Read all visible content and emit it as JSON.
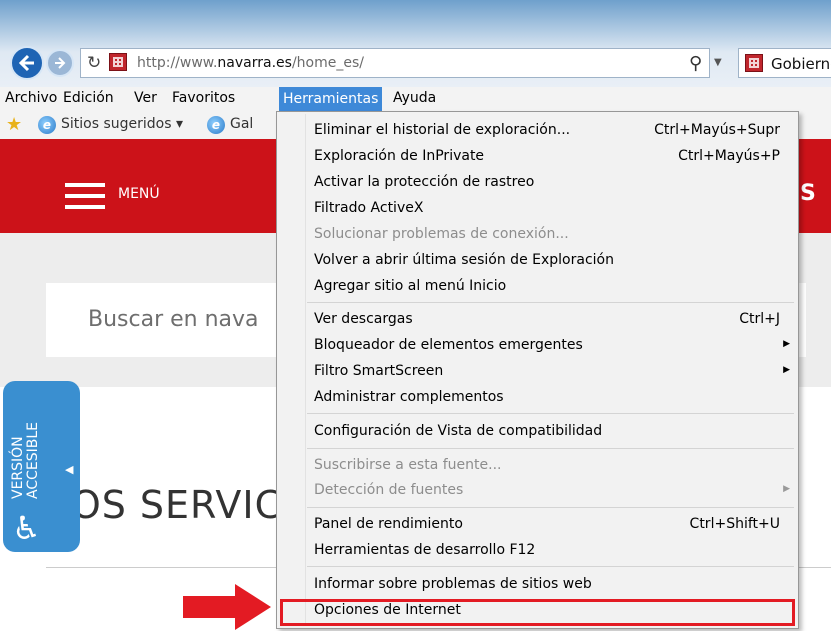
{
  "browser": {
    "url_prefix": "http://www.",
    "url_domain": "navarra.es",
    "url_path": "/home_es/",
    "tab_title": "Gobierno"
  },
  "menubar": {
    "items": [
      "Archivo",
      "Edición",
      "Ver",
      "Favoritos",
      "Herramientas",
      "Ayuda"
    ],
    "active": "Herramientas"
  },
  "favorites_bar": {
    "suggested": "Sitios sugeridos",
    "gallery": "Gal"
  },
  "page": {
    "menu_label": "MENÚ",
    "header_right": "S",
    "search_placeholder": "Buscar en nava",
    "services_title": "LOS SERVIC",
    "accessible_line1": "VERSIÓN",
    "accessible_line2": "ACCESIBLE"
  },
  "dropdown": {
    "items": [
      {
        "label": "Eliminar el historial de exploración...",
        "shortcut": "Ctrl+Mayús+Supr",
        "disabled": false
      },
      {
        "label": "Exploración de InPrivate",
        "shortcut": "Ctrl+Mayús+P",
        "disabled": false
      },
      {
        "label": "Activar la protección de rastreo",
        "shortcut": "",
        "disabled": false
      },
      {
        "label": "Filtrado ActiveX",
        "shortcut": "",
        "disabled": false
      },
      {
        "label": "Solucionar problemas de conexión...",
        "shortcut": "",
        "disabled": true
      },
      {
        "label": "Volver a abrir última sesión de Exploración",
        "shortcut": "",
        "disabled": false
      },
      {
        "label": "Agregar sitio al menú Inicio",
        "shortcut": "",
        "disabled": false
      },
      {
        "label": "Ver descargas",
        "shortcut": "Ctrl+J",
        "disabled": false
      },
      {
        "label": "Bloqueador de elementos emergentes",
        "shortcut": "",
        "disabled": false,
        "submenu": true
      },
      {
        "label": "Filtro SmartScreen",
        "shortcut": "",
        "disabled": false,
        "submenu": true
      },
      {
        "label": "Administrar complementos",
        "shortcut": "",
        "disabled": false
      },
      {
        "label": "Configuración de Vista de compatibilidad",
        "shortcut": "",
        "disabled": false
      },
      {
        "label": "Suscribirse a esta fuente...",
        "shortcut": "",
        "disabled": true
      },
      {
        "label": "Detección de fuentes",
        "shortcut": "",
        "disabled": true,
        "submenu": true
      },
      {
        "label": "Panel de rendimiento",
        "shortcut": "Ctrl+Shift+U",
        "disabled": false
      },
      {
        "label": "Herramientas de desarrollo F12",
        "shortcut": "",
        "disabled": false
      },
      {
        "label": "Informar sobre problemas de sitios web",
        "shortcut": "",
        "disabled": false
      },
      {
        "label": "Opciones de Internet",
        "shortcut": "",
        "disabled": false,
        "highlighted": true
      }
    ]
  },
  "colors": {
    "accent_red": "#cc1219",
    "menu_active": "#3e89d8",
    "highlight_border": "#e31b23",
    "accessible_blue": "#3a8fd0"
  }
}
